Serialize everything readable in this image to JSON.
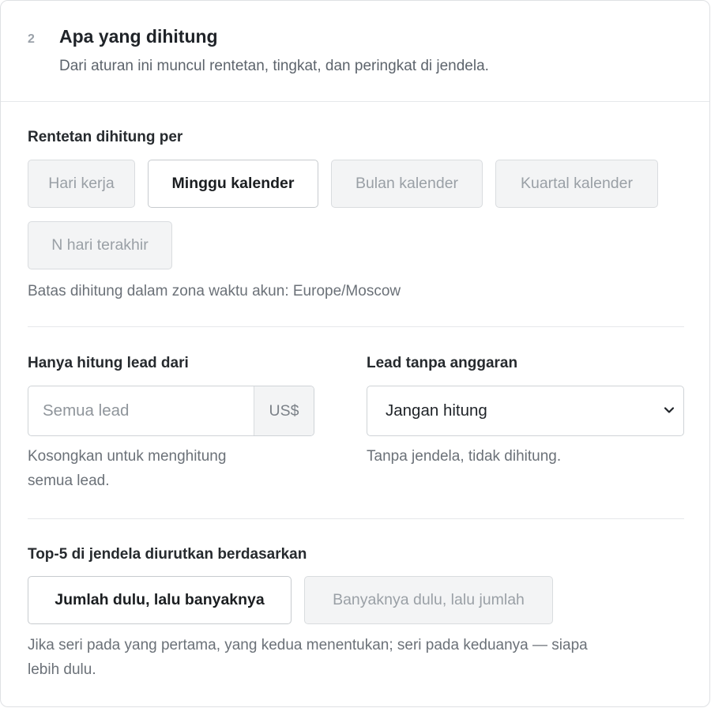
{
  "section": {
    "step": "2",
    "title": "Apa yang dihitung",
    "subtitle": "Dari aturan ini muncul rentetan, tingkat, dan peringkat di jendela."
  },
  "streak": {
    "label": "Rentetan dihitung per",
    "options": [
      "Hari kerja",
      "Minggu kalender",
      "Bulan kalender",
      "Kuartal kalender",
      "N hari terakhir"
    ],
    "selected": "Minggu kalender",
    "hint": "Batas dihitung dalam zona waktu akun: Europe/Moscow"
  },
  "min_lead": {
    "label": "Hanya hitung lead dari",
    "placeholder": "Semua lead",
    "value": "",
    "currency": "US$",
    "hint_line1": "Kosongkan untuk menghitung",
    "hint_line2": "semua lead."
  },
  "no_budget": {
    "label": "Lead tanpa anggaran",
    "selected": "Jangan hitung",
    "hint": "Tanpa jendela, tidak dihitung."
  },
  "top5": {
    "label": "Top-5 di jendela diurutkan berdasarkan",
    "options": [
      "Jumlah dulu, lalu banyaknya",
      "Banyaknya dulu, lalu jumlah"
    ],
    "selected": "Jumlah dulu, lalu banyaknya",
    "hint_line1": "Jika seri pada yang pertama, yang kedua menentukan; seri pada keduanya — siapa",
    "hint_line2": "lebih dulu."
  },
  "icons": {
    "select_arrow": "chevron-down-icon"
  }
}
